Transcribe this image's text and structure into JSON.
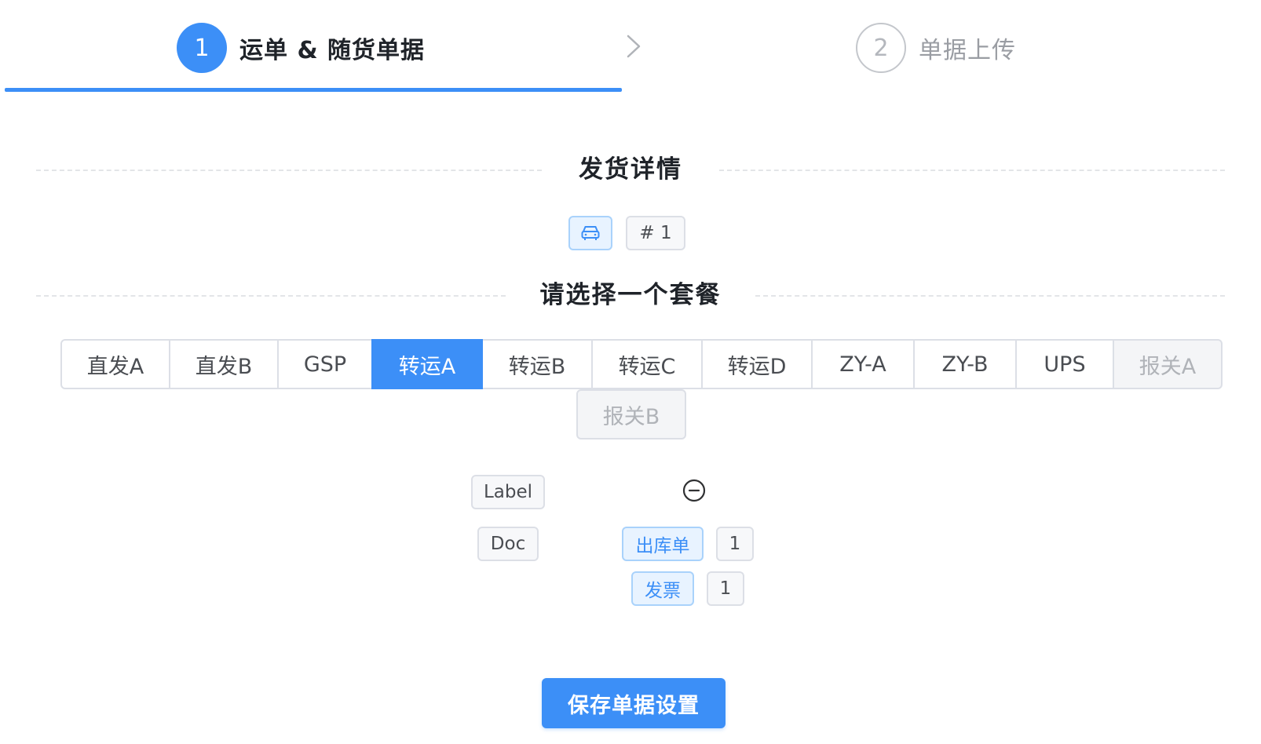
{
  "steps": [
    {
      "number": "1",
      "label": "运单 & 随货单据",
      "state": "active"
    },
    {
      "number": "2",
      "label": "单据上传",
      "state": "inactive"
    }
  ],
  "details": {
    "title": "发货详情",
    "truck_icon": "truck-icon",
    "count_label": "# 1"
  },
  "packages": {
    "title": "请选择一个套餐",
    "selected": "转运A",
    "items": [
      {
        "label": "直发A",
        "state": "normal"
      },
      {
        "label": "直发B",
        "state": "normal"
      },
      {
        "label": "GSP",
        "state": "normal"
      },
      {
        "label": "转运A",
        "state": "active"
      },
      {
        "label": "转运B",
        "state": "normal"
      },
      {
        "label": "转运C",
        "state": "normal"
      },
      {
        "label": "转运D",
        "state": "normal"
      },
      {
        "label": "ZY-A",
        "state": "normal"
      },
      {
        "label": "ZY-B",
        "state": "normal"
      },
      {
        "label": "UPS",
        "state": "normal"
      },
      {
        "label": "报关A",
        "state": "disabled"
      },
      {
        "label": "报关B",
        "state": "disabled"
      }
    ]
  },
  "documents": {
    "label_tag": "Label",
    "doc_tag": "Doc",
    "items": [
      {
        "name": "出库单",
        "count": "1"
      },
      {
        "name": "发票",
        "count": "1"
      }
    ]
  },
  "save_button": "保存单据设置",
  "colors": {
    "primary": "#3c8ff7",
    "tag_blue_bg": "#e8f3ff",
    "disabled_bg": "#f4f5f7"
  }
}
